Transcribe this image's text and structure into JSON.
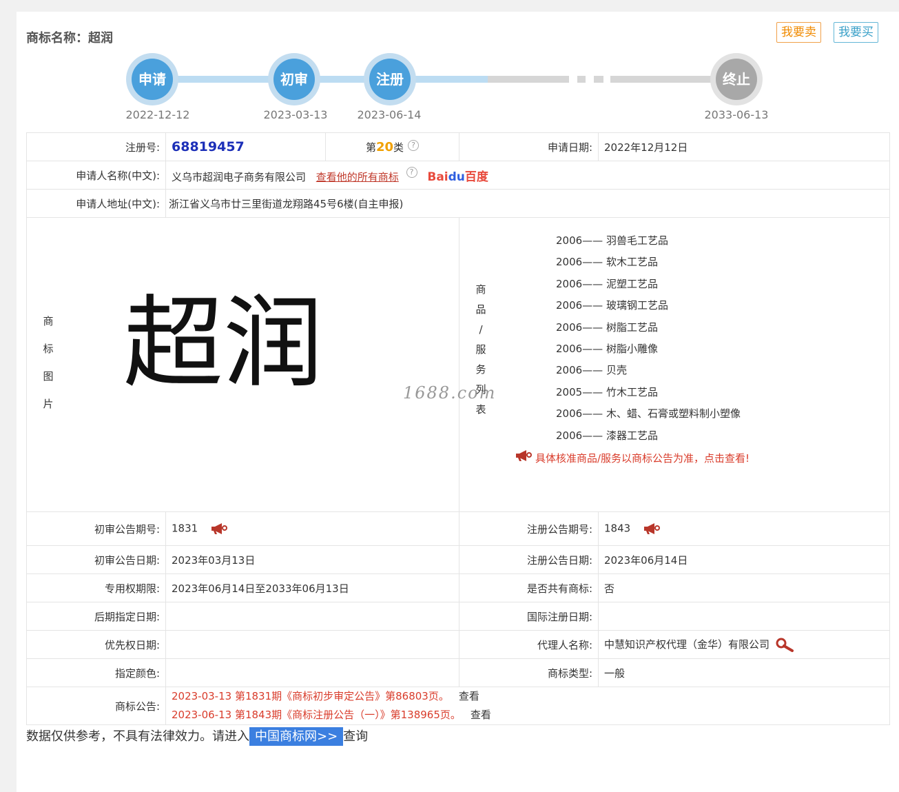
{
  "header": {
    "title": "商标名称：超润",
    "sell_label": "我要卖",
    "buy_label": "我要买"
  },
  "timeline": {
    "steps": [
      {
        "label": "申请",
        "date": "2022-12-12"
      },
      {
        "label": "初审",
        "date": "2023-03-13"
      },
      {
        "label": "注册",
        "date": "2023-06-14"
      },
      {
        "label": "终止",
        "date": "2033-06-13"
      }
    ]
  },
  "info": {
    "reg_no_label": "注册号:",
    "reg_no": "68819457",
    "class_prefix": "第",
    "class_num": "20",
    "class_suffix": "类",
    "apply_date_label": "申请日期:",
    "apply_date": "2022年12月12日",
    "applicant_label": "申请人名称(中文):",
    "applicant": "义乌市超润电子商务有限公司",
    "view_all_label": "查看他的所有商标",
    "baidu_a": "Bai",
    "baidu_paw": "du",
    "baidu_b": "百度",
    "address_label": "申请人地址(中文):",
    "address": "浙江省义乌市廿三里街道龙翔路45号6楼(自主申报)",
    "image_label": [
      "商",
      "标",
      "图",
      "片"
    ],
    "trademark_text": "超润",
    "watermark": "1688.com",
    "goods_label": [
      "商",
      "品",
      "/",
      "服",
      "务",
      "列",
      "表"
    ],
    "goods": [
      "2006—— 羽兽毛工艺品",
      "2006—— 软木工艺品",
      "2006—— 泥塑工艺品",
      "2006—— 玻璃钢工艺品",
      "2006—— 树脂工艺品",
      "2006—— 树脂小雕像",
      "2006—— 贝壳",
      "2005—— 竹木工艺品",
      "2006—— 木、蜡、石膏或塑料制小塑像",
      "2006—— 漆器工艺品"
    ],
    "goods_notice": "具体核准商品/服务以商标公告为准，点击查看!",
    "prelim_no_label": "初审公告期号:",
    "prelim_no": "1831",
    "reg_pub_no_label": "注册公告期号:",
    "reg_pub_no": "1843",
    "prelim_date_label": "初审公告日期:",
    "prelim_date": "2023年03月13日",
    "reg_pub_date_label": "注册公告日期:",
    "reg_pub_date": "2023年06月14日",
    "term_label": "专用权期限:",
    "term": "2023年06月14日至2033年06月13日",
    "shared_label": "是否共有商标:",
    "shared": "否",
    "later_label": "后期指定日期:",
    "later": "",
    "intl_label": "国际注册日期:",
    "intl": "",
    "priority_label": "优先权日期:",
    "priority": "",
    "agent_label": "代理人名称:",
    "agent": "中慧知识产权代理（金华）有限公司",
    "color_label": "指定颜色:",
    "color": "",
    "type_label": "商标类型:",
    "type": "一般",
    "pub_label": "商标公告:",
    "pubs": [
      {
        "text": "2023-03-13 第1831期《商标初步审定公告》第86803页。",
        "view": "查看"
      },
      {
        "text": "2023-06-13 第1843期《商标注册公告（一）》第138965页。",
        "view": "查看"
      }
    ]
  },
  "footer": {
    "prefix": "数据仅供参考，不具有法律效力。请进入",
    "link": "中国商标网>>",
    "suffix": "查询"
  },
  "colors": {
    "accent_blue": "#4aa0dc",
    "regno_blue": "#1c2fb8",
    "class_orange": "#f0a000",
    "notice_red": "#d93c2b"
  }
}
